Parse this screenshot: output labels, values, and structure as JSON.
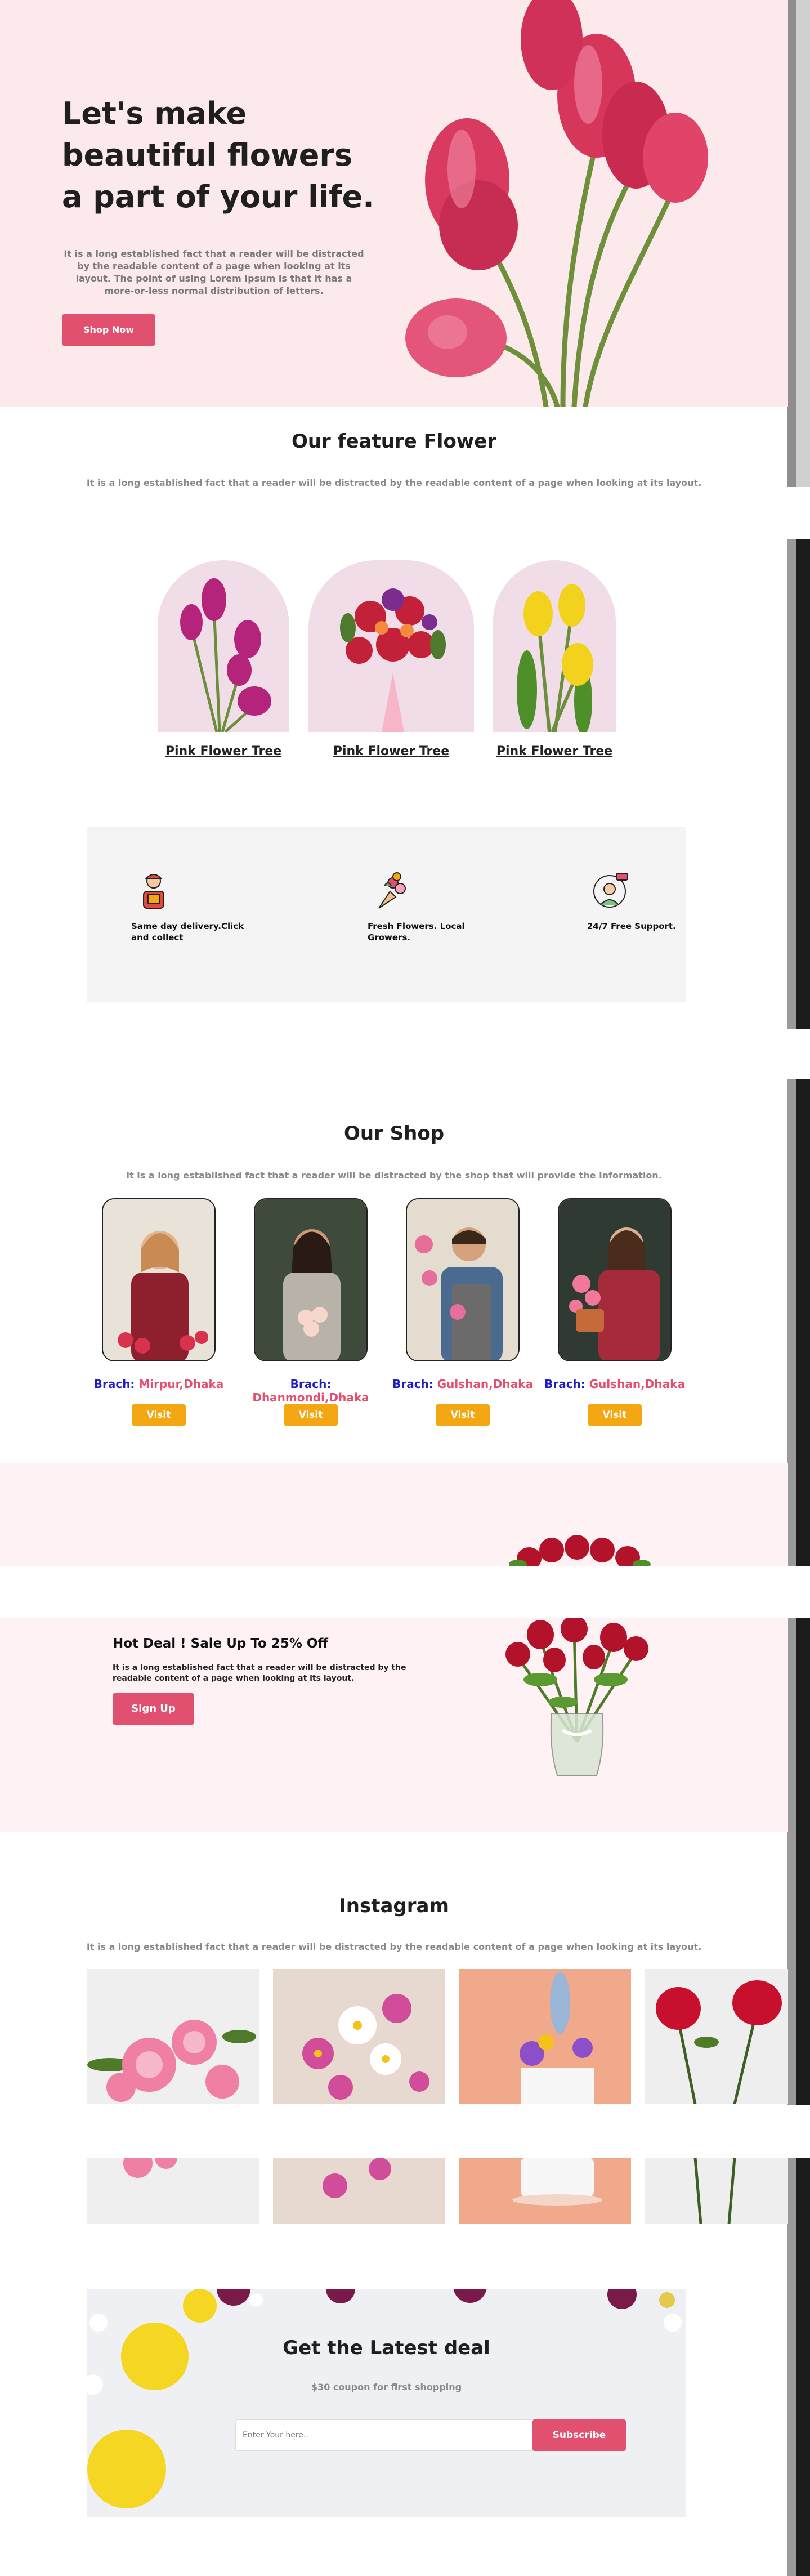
{
  "hero": {
    "title": "Let's make beautiful flowers a part of your life.",
    "description": "It is a long established fact that a reader will be distracted by the readable content of a page when looking at its layout. The point of using Lorem Ipsum is that it has a more-or-less normal distribution of letters.",
    "button": "Shop Now"
  },
  "feature": {
    "title": "Our feature Flower",
    "subtitle": "It is a long established fact that a reader will be distracted by the readable content of a page when looking at its layout.",
    "cards": [
      {
        "label": "Pink Flower Tree"
      },
      {
        "label": "Pink Flower Tree"
      },
      {
        "label": "Pink Flower Tree"
      }
    ]
  },
  "services": [
    {
      "text": "Same day delivery.Click and collect",
      "icon": "delivery-person-icon"
    },
    {
      "text": "Fresh Flowers. Local Growers.",
      "icon": "bouquet-icon"
    },
    {
      "text": "24/7 Free Support.",
      "icon": "support-agent-icon"
    }
  ],
  "shop": {
    "title": "Our Shop",
    "subtitle": "It is a long established fact that a reader will be distracted by the shop that will provide the information.",
    "branch_label": "Brach:",
    "visit_label": "Visit",
    "branches": [
      "Mirpur,Dhaka",
      "Dhanmondi,Dhaka",
      "Gulshan,Dhaka",
      "Gulshan,Dhaka"
    ]
  },
  "deal": {
    "title": "Hot Deal ! Sale Up To 25% Off",
    "description": "It is a long established fact that a reader will be distracted by the readable content of a page when looking at its layout.",
    "button": "Sign Up"
  },
  "instagram": {
    "title": "Instagram",
    "subtitle": "It is a long established fact that a reader will be distracted by the readable content of a page when looking at its layout."
  },
  "newsletter": {
    "title": "Get the Latest deal",
    "subtitle": "$30 coupon for first shopping",
    "input_placeholder": "Enter Your here..",
    "button": "Subscribe"
  },
  "colors": {
    "accent": "#e2506f",
    "visit": "#f3a712",
    "hero_bg": "#fbe9ec",
    "branch_label": "#1f1fbf"
  }
}
